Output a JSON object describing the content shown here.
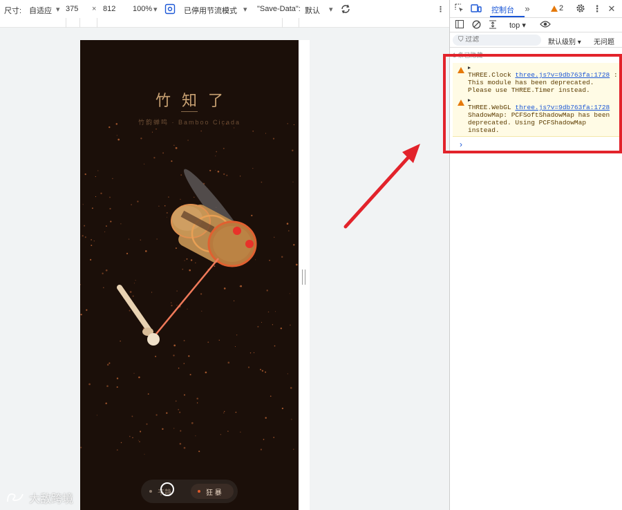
{
  "device_toolbar": {
    "dimensions_label": "尺寸:",
    "device_preset": "自适应",
    "width": "375",
    "times": "×",
    "height": "812",
    "zoom": "100%",
    "throttle": "已停用节流模式",
    "save_data_label": "\"Save-Data\":",
    "save_data_value": "默认"
  },
  "app": {
    "title": "竹知了",
    "subtitle": "竹韵蝉鸣 · Bamboo Cicada",
    "modes": [
      {
        "label": "平静",
        "dot_color": "#8b7a6c"
      },
      {
        "label": "狂 暴",
        "dot_color": "#e05a2a"
      }
    ]
  },
  "watermark": {
    "text": "大敌跨境"
  },
  "devtools": {
    "tab_console": "控制台",
    "warning_count": "2",
    "context": "top",
    "filter_placeholder": "过滤",
    "level": "默认级别",
    "issues": "无问题",
    "hidden_label": "1 条已隐藏",
    "messages": [
      {
        "prefix": "THREE.Clock",
        "link": "three.js?v=9db763fa:1728",
        "text": ": This module has been deprecated. Please use THREE.Timer instead."
      },
      {
        "prefix": "THREE.WebGL",
        "link": "three.js?v=9db763fa:1728",
        "text": "ShadowMap: PCFSoftShadowMap has been deprecated. Using PCFShadowMap instead."
      }
    ],
    "prompt": "›"
  },
  "colors": {
    "highlight": "#e2232b",
    "warning": "#e5790b",
    "accent": "#1a56d6",
    "app_bg": "#1b0f09"
  }
}
